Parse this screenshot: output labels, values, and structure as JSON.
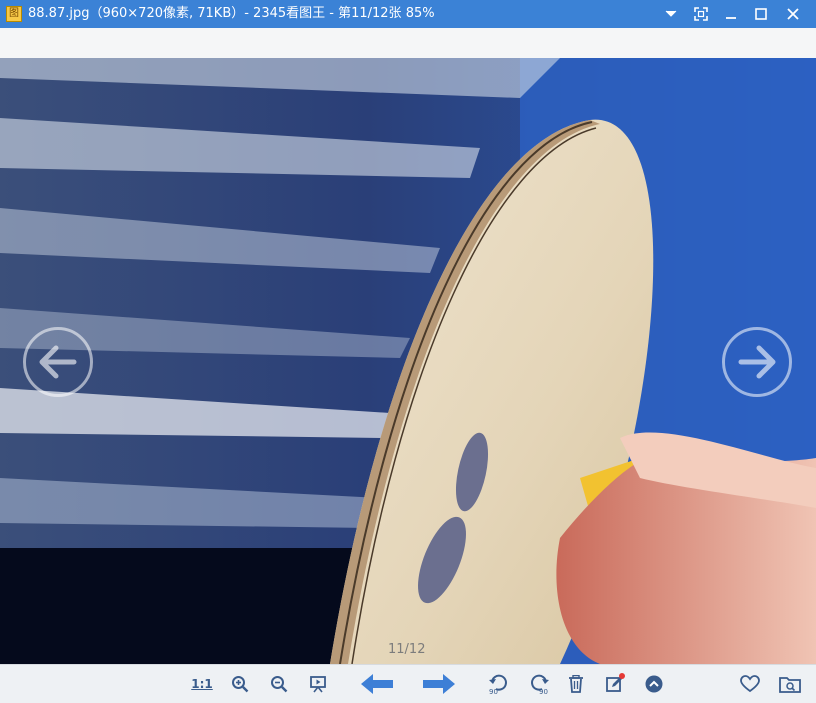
{
  "window": {
    "title": "88.87.jpg（960×720像素, 71KB）- 2345看图王 - 第11/12张 85%",
    "app_icon": "image-viewer-app-icon"
  },
  "viewer": {
    "counter": "11/12",
    "image_description_colors": {
      "background_dark": "#0b1430",
      "wood": "#e9dcc2",
      "logo": "#6b6f8f"
    }
  },
  "toolbar": {
    "actual_size_label": "1:1",
    "rotate_left_label": "90",
    "rotate_right_label": "90",
    "items": [
      "actual-size",
      "zoom-in-icon",
      "zoom-out-icon",
      "slideshow-icon",
      "previous-arrow-icon",
      "next-arrow-icon",
      "rotate-left-icon",
      "rotate-right-icon",
      "delete-icon",
      "edit-icon",
      "expand-up-icon",
      "favorite-heart-icon",
      "open-folder-icon"
    ]
  },
  "colors": {
    "titlebar": "#3b82d6",
    "accent": "#3d7fd6",
    "icon": "#3a5c8c",
    "notify": "#e53935"
  }
}
